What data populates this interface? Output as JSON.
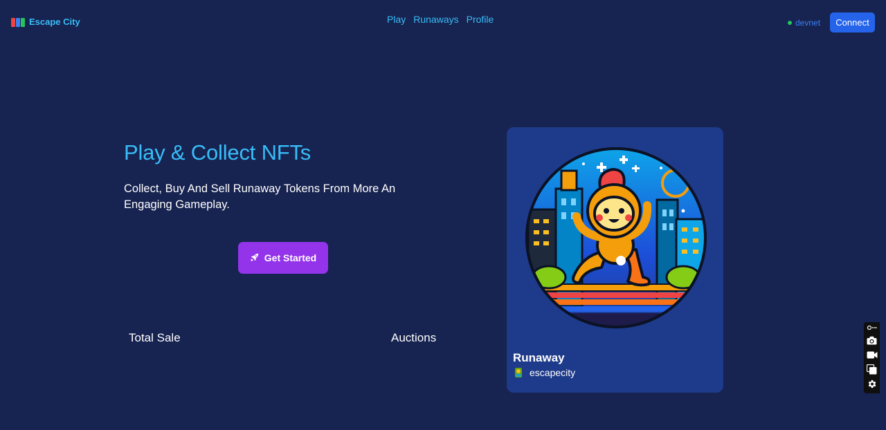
{
  "header": {
    "brand_name": "Escape City",
    "nav": [
      "Play",
      "Runaways",
      "Profile"
    ],
    "network": "devnet",
    "connect_label": "Connect"
  },
  "hero": {
    "title": "Play & Collect NFTs",
    "subtitle": "Collect, Buy And Sell Runaway Tokens From More An Engaging Gameplay.",
    "cta_label": "Get Started"
  },
  "stats": {
    "total_sale_label": "Total Sale",
    "auctions_label": "Auctions"
  },
  "card": {
    "title": "Runaway",
    "owner": "escapecity"
  },
  "icons": {
    "brand": "building-blocks-icon",
    "cta": "rocket-icon",
    "toolbar": [
      "screenshot-icon",
      "camera-icon",
      "video-icon",
      "copy-icon",
      "settings-icon"
    ]
  },
  "colors": {
    "background": "#172350",
    "accent": "#38bdf8",
    "connect": "#2563eb",
    "cta": "#9333ea",
    "card": "#1e3a8a",
    "online": "#22c55e"
  }
}
